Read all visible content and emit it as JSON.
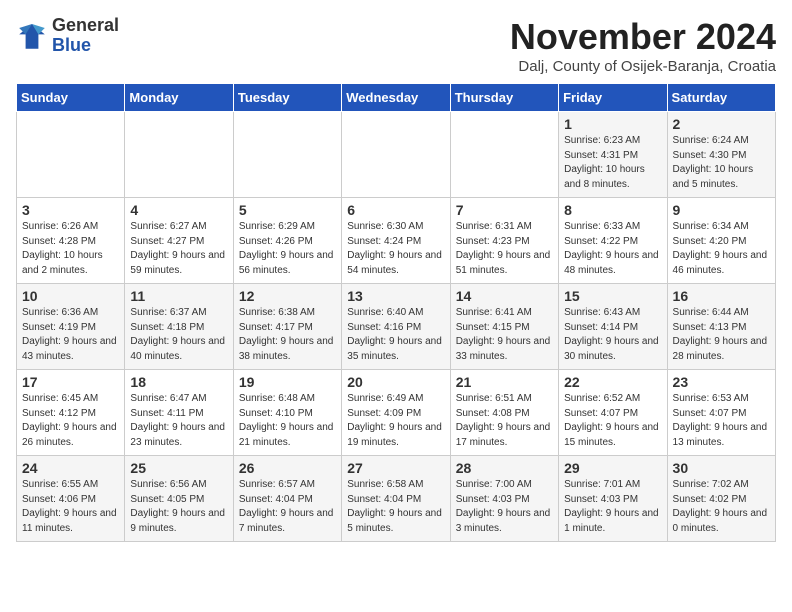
{
  "logo": {
    "general": "General",
    "blue": "Blue"
  },
  "title": "November 2024",
  "location": "Dalj, County of Osijek-Baranja, Croatia",
  "days_of_week": [
    "Sunday",
    "Monday",
    "Tuesday",
    "Wednesday",
    "Thursday",
    "Friday",
    "Saturday"
  ],
  "weeks": [
    [
      {
        "day": "",
        "info": ""
      },
      {
        "day": "",
        "info": ""
      },
      {
        "day": "",
        "info": ""
      },
      {
        "day": "",
        "info": ""
      },
      {
        "day": "",
        "info": ""
      },
      {
        "day": "1",
        "info": "Sunrise: 6:23 AM\nSunset: 4:31 PM\nDaylight: 10 hours and 8 minutes."
      },
      {
        "day": "2",
        "info": "Sunrise: 6:24 AM\nSunset: 4:30 PM\nDaylight: 10 hours and 5 minutes."
      }
    ],
    [
      {
        "day": "3",
        "info": "Sunrise: 6:26 AM\nSunset: 4:28 PM\nDaylight: 10 hours and 2 minutes."
      },
      {
        "day": "4",
        "info": "Sunrise: 6:27 AM\nSunset: 4:27 PM\nDaylight: 9 hours and 59 minutes."
      },
      {
        "day": "5",
        "info": "Sunrise: 6:29 AM\nSunset: 4:26 PM\nDaylight: 9 hours and 56 minutes."
      },
      {
        "day": "6",
        "info": "Sunrise: 6:30 AM\nSunset: 4:24 PM\nDaylight: 9 hours and 54 minutes."
      },
      {
        "day": "7",
        "info": "Sunrise: 6:31 AM\nSunset: 4:23 PM\nDaylight: 9 hours and 51 minutes."
      },
      {
        "day": "8",
        "info": "Sunrise: 6:33 AM\nSunset: 4:22 PM\nDaylight: 9 hours and 48 minutes."
      },
      {
        "day": "9",
        "info": "Sunrise: 6:34 AM\nSunset: 4:20 PM\nDaylight: 9 hours and 46 minutes."
      }
    ],
    [
      {
        "day": "10",
        "info": "Sunrise: 6:36 AM\nSunset: 4:19 PM\nDaylight: 9 hours and 43 minutes."
      },
      {
        "day": "11",
        "info": "Sunrise: 6:37 AM\nSunset: 4:18 PM\nDaylight: 9 hours and 40 minutes."
      },
      {
        "day": "12",
        "info": "Sunrise: 6:38 AM\nSunset: 4:17 PM\nDaylight: 9 hours and 38 minutes."
      },
      {
        "day": "13",
        "info": "Sunrise: 6:40 AM\nSunset: 4:16 PM\nDaylight: 9 hours and 35 minutes."
      },
      {
        "day": "14",
        "info": "Sunrise: 6:41 AM\nSunset: 4:15 PM\nDaylight: 9 hours and 33 minutes."
      },
      {
        "day": "15",
        "info": "Sunrise: 6:43 AM\nSunset: 4:14 PM\nDaylight: 9 hours and 30 minutes."
      },
      {
        "day": "16",
        "info": "Sunrise: 6:44 AM\nSunset: 4:13 PM\nDaylight: 9 hours and 28 minutes."
      }
    ],
    [
      {
        "day": "17",
        "info": "Sunrise: 6:45 AM\nSunset: 4:12 PM\nDaylight: 9 hours and 26 minutes."
      },
      {
        "day": "18",
        "info": "Sunrise: 6:47 AM\nSunset: 4:11 PM\nDaylight: 9 hours and 23 minutes."
      },
      {
        "day": "19",
        "info": "Sunrise: 6:48 AM\nSunset: 4:10 PM\nDaylight: 9 hours and 21 minutes."
      },
      {
        "day": "20",
        "info": "Sunrise: 6:49 AM\nSunset: 4:09 PM\nDaylight: 9 hours and 19 minutes."
      },
      {
        "day": "21",
        "info": "Sunrise: 6:51 AM\nSunset: 4:08 PM\nDaylight: 9 hours and 17 minutes."
      },
      {
        "day": "22",
        "info": "Sunrise: 6:52 AM\nSunset: 4:07 PM\nDaylight: 9 hours and 15 minutes."
      },
      {
        "day": "23",
        "info": "Sunrise: 6:53 AM\nSunset: 4:07 PM\nDaylight: 9 hours and 13 minutes."
      }
    ],
    [
      {
        "day": "24",
        "info": "Sunrise: 6:55 AM\nSunset: 4:06 PM\nDaylight: 9 hours and 11 minutes."
      },
      {
        "day": "25",
        "info": "Sunrise: 6:56 AM\nSunset: 4:05 PM\nDaylight: 9 hours and 9 minutes."
      },
      {
        "day": "26",
        "info": "Sunrise: 6:57 AM\nSunset: 4:04 PM\nDaylight: 9 hours and 7 minutes."
      },
      {
        "day": "27",
        "info": "Sunrise: 6:58 AM\nSunset: 4:04 PM\nDaylight: 9 hours and 5 minutes."
      },
      {
        "day": "28",
        "info": "Sunrise: 7:00 AM\nSunset: 4:03 PM\nDaylight: 9 hours and 3 minutes."
      },
      {
        "day": "29",
        "info": "Sunrise: 7:01 AM\nSunset: 4:03 PM\nDaylight: 9 hours and 1 minute."
      },
      {
        "day": "30",
        "info": "Sunrise: 7:02 AM\nSunset: 4:02 PM\nDaylight: 9 hours and 0 minutes."
      }
    ]
  ]
}
